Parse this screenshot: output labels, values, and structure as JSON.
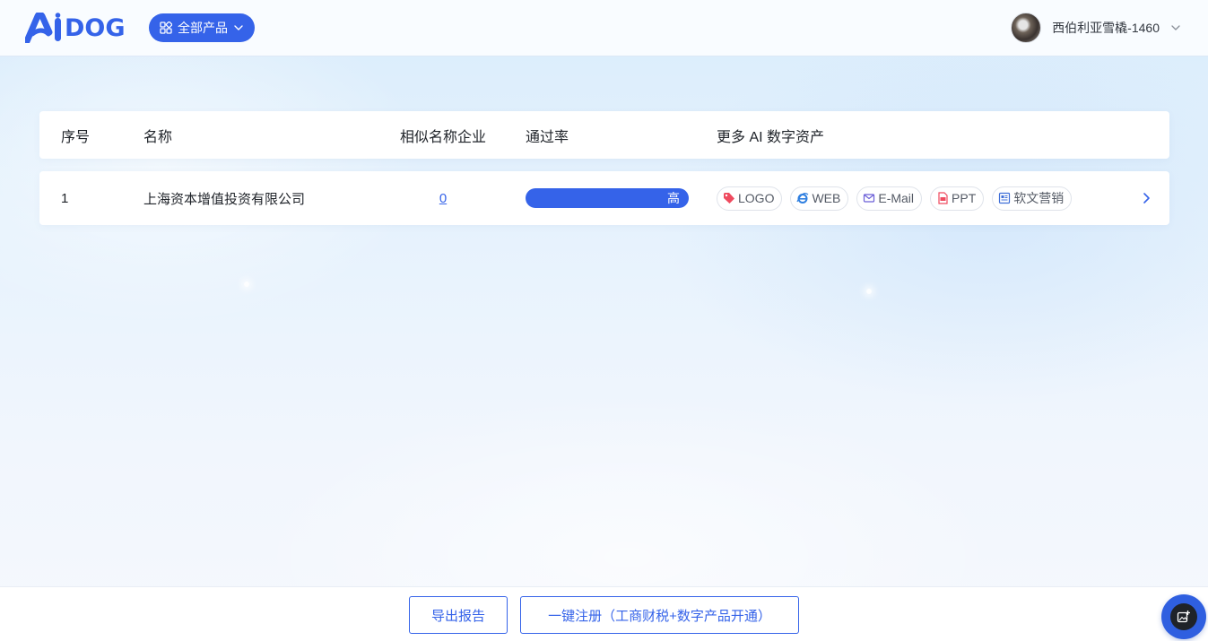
{
  "header": {
    "logo_text": "DOG",
    "products_label": "全部产品",
    "user_name": "西伯利亚雪橇-1460"
  },
  "table": {
    "columns": [
      "序号",
      "名称",
      "相似名称企业",
      "通过率",
      "更多 AI 数字资产"
    ],
    "rows": [
      {
        "index": "1",
        "name": "上海资本增值投资有限公司",
        "similar_count": "0",
        "pass_rate_label": "高",
        "pass_rate": 1.0,
        "assets": [
          {
            "label": "LOGO",
            "icon": "tag-icon",
            "color": "#ef4b5f"
          },
          {
            "label": "WEB",
            "icon": "ie-browser-icon",
            "color": "#2f7fe0"
          },
          {
            "label": "E-Mail",
            "icon": "mail-icon",
            "color": "#6b5fd8"
          },
          {
            "label": "PPT",
            "icon": "ppt-file-icon",
            "color": "#ef4b5f"
          },
          {
            "label": "软文营销",
            "icon": "article-icon",
            "color": "#3f6fd8"
          }
        ]
      }
    ]
  },
  "footer": {
    "export_label": "导出报告",
    "register_label": "一键注册（工商财税+数字产品开通）"
  },
  "colors": {
    "brand": "#3563e9",
    "fab": "#2f5fe0"
  }
}
